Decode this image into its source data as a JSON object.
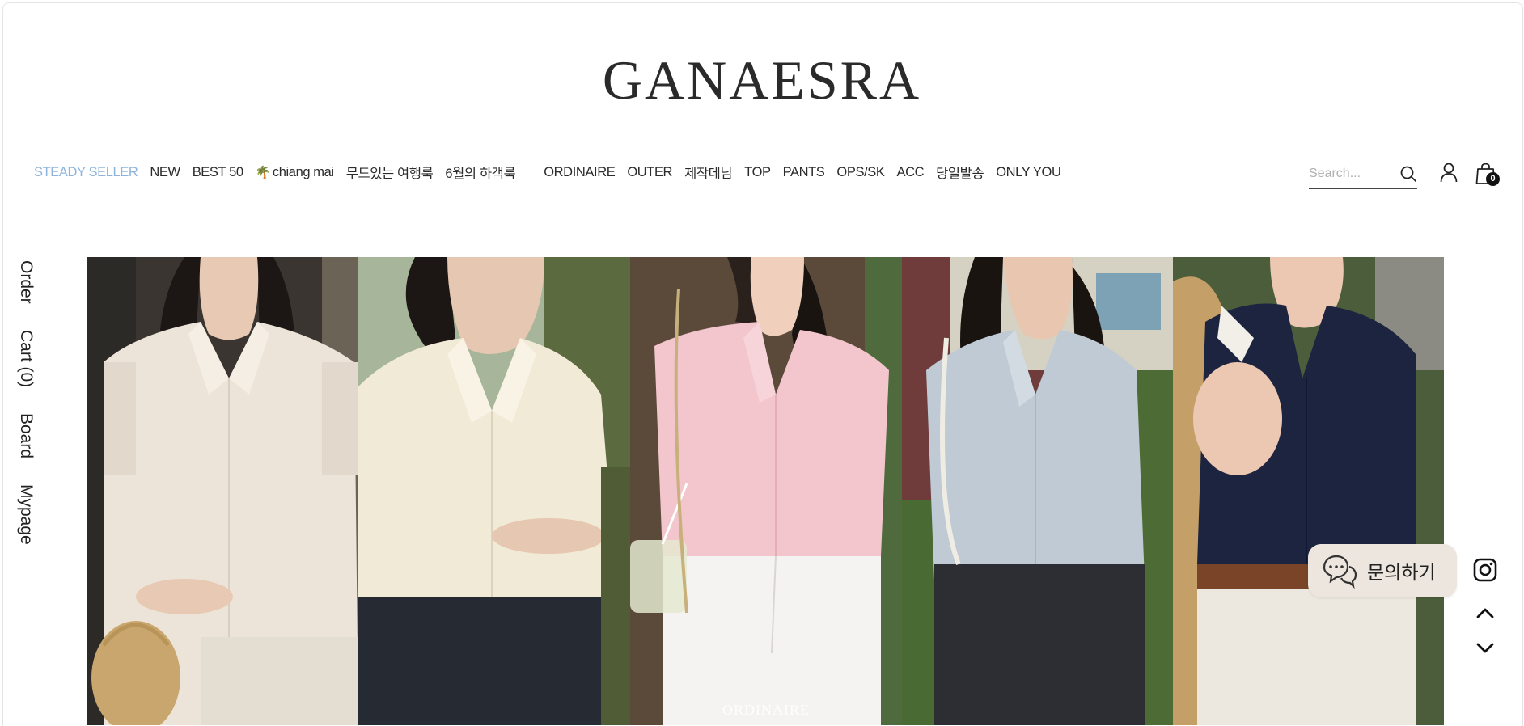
{
  "brand": {
    "logo_text": "GANAESRA"
  },
  "nav": {
    "items": [
      {
        "label": "STEADY SELLER"
      },
      {
        "label": "NEW"
      },
      {
        "label": "BEST 50"
      },
      {
        "label": "chiang mai",
        "icon": "palm-tree-icon"
      },
      {
        "label": "무드있는 여행룩"
      },
      {
        "label": "6월의 하객룩"
      },
      {
        "label": "ORDINAIRE"
      },
      {
        "label": "OUTER"
      },
      {
        "label": "제작데님"
      },
      {
        "label": "TOP"
      },
      {
        "label": "PANTS"
      },
      {
        "label": "OPS/SK"
      },
      {
        "label": "ACC"
      },
      {
        "label": "당일발송"
      },
      {
        "label": "ONLY YOU"
      }
    ],
    "highlight_color": "#8fb4dc"
  },
  "header": {
    "search_placeholder": "Search...",
    "cart_count": "0",
    "icons": [
      "search-icon",
      "user-icon",
      "shopping-bag-icon"
    ]
  },
  "side_menu": {
    "items": [
      "Order",
      "Cart (0)",
      "Board",
      "Mypage"
    ]
  },
  "banner": {
    "panels": [
      {
        "name": "cream-shirt",
        "shirt_color": "#ece4d8"
      },
      {
        "name": "ivory-shirt",
        "shirt_color": "#f1ead7"
      },
      {
        "name": "pink-shirt",
        "shirt_color": "#f3c6cd"
      },
      {
        "name": "sky-shirt",
        "shirt_color": "#bfcad4"
      },
      {
        "name": "navy-shirt",
        "shirt_color": "#1d2440"
      }
    ],
    "watermark": "ORDINAIRE"
  },
  "floating": {
    "chat_label": "문의하기",
    "icons": [
      "chat-icon",
      "instagram-icon",
      "chevron-up-icon",
      "chevron-down-icon"
    ]
  }
}
